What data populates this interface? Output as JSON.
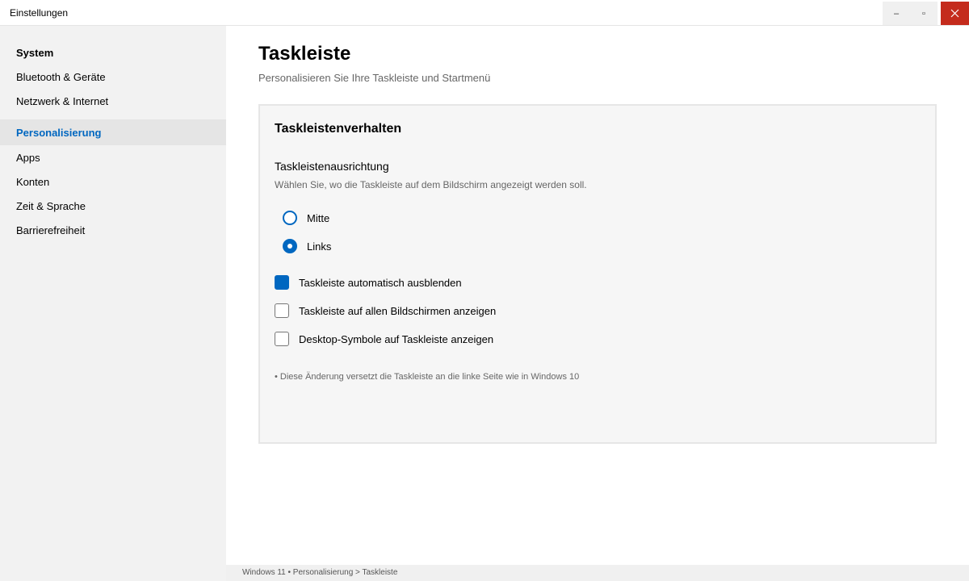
{
  "window": {
    "title": "Einstellungen",
    "minimize_label": "–",
    "maximize_label": "▫",
    "close_icon": "close-icon",
    "close_color": "#c42b1c"
  },
  "sidebar": {
    "items": [
      {
        "label": "System",
        "style": "bold"
      },
      {
        "label": "Bluetooth & Geräte"
      },
      {
        "label": "Netzwerk & Internet"
      },
      {
        "label": "Personalisierung",
        "active": true
      },
      {
        "label": "Apps"
      },
      {
        "label": "Konten"
      },
      {
        "label": "Zeit & Sprache"
      },
      {
        "label": "Barrierefreiheit"
      }
    ]
  },
  "main": {
    "title": "Taskleiste",
    "subtitle": "Personalisieren Sie Ihre Taskleiste und Startmenü",
    "card": {
      "title": "Taskleistenverhalten",
      "section_label": "Taskleistenausrichtung",
      "section_desc": "Wählen Sie, wo die Taskleiste auf dem Bildschirm angezeigt werden soll.",
      "radio_options": [
        {
          "label": "Mitte",
          "checked": false
        },
        {
          "label": "Links",
          "checked": true
        }
      ],
      "checkboxes": [
        {
          "label": "Taskleiste automatisch ausblenden",
          "checked": true
        },
        {
          "label": "Taskleiste auf allen Bildschirmen anzeigen",
          "checked": false
        },
        {
          "label": "Desktop-Symbole auf Taskleiste anzeigen",
          "checked": false
        }
      ],
      "note": "• Diese Änderung versetzt die Taskleiste an die linke Seite wie in Windows 10"
    }
  },
  "statusbar": {
    "text": "Windows 11 • Personalisierung > Taskleiste"
  },
  "colors": {
    "accent": "#0067c0",
    "sidebar_bg": "#f2f2f2",
    "card_bg": "#f6f6f6"
  }
}
